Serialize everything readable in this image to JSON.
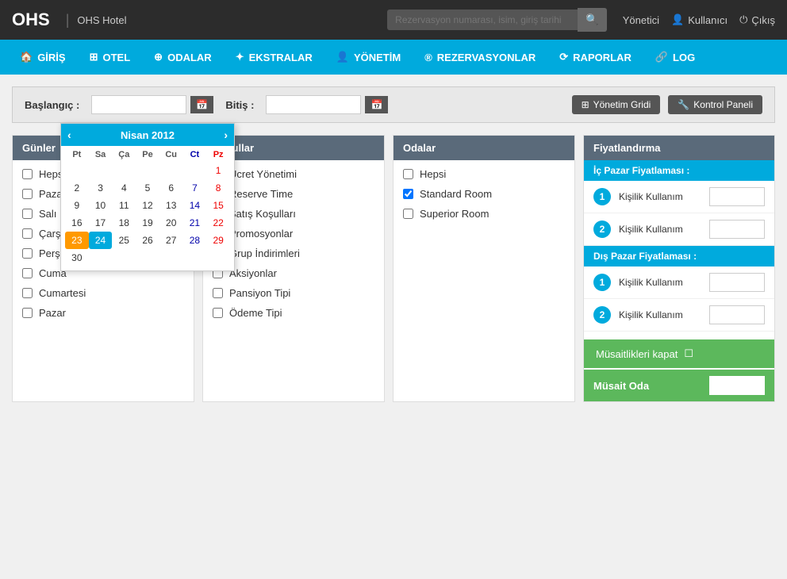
{
  "app": {
    "logo": "OHS",
    "hotel_name": "OHS Hotel",
    "search_placeholder": "Rezervasyon numarası, isim, giriş tarihi"
  },
  "topbar": {
    "manager_label": "Yönetici",
    "user_label": "Kullanıcı",
    "logout_label": "Çıkış"
  },
  "nav": {
    "items": [
      {
        "id": "giris",
        "icon": "🏠",
        "label": "GİRİŞ"
      },
      {
        "id": "otel",
        "icon": "🏨",
        "label": "OTEL"
      },
      {
        "id": "odalar",
        "icon": "🔲",
        "label": "ODALAR"
      },
      {
        "id": "ekstralar",
        "icon": "➕",
        "label": "EKSTRALAR"
      },
      {
        "id": "yonetim",
        "icon": "👤",
        "label": "YÖNETİM"
      },
      {
        "id": "rezervasyonlar",
        "icon": "®",
        "label": "REZERVASYONLAR"
      },
      {
        "id": "raporlar",
        "icon": "🔄",
        "label": "RAPORLAR"
      },
      {
        "id": "log",
        "icon": "🔗",
        "label": "LOG"
      }
    ]
  },
  "filter": {
    "start_label": "Başlangıç :",
    "end_label": "Bitiş :",
    "start_value": "",
    "end_value": "",
    "yonetim_grid": "Yönetim Gridi",
    "kontrol_panel": "Kontrol Paneli"
  },
  "calendar": {
    "title": "Nisan 2012",
    "day_headers": [
      "Pt",
      "Sa",
      "Ça",
      "Pe",
      "Cu",
      "Ct",
      "Pz"
    ],
    "weeks": [
      [
        "",
        "",
        "",
        "",
        "",
        "",
        "1"
      ],
      [
        "2",
        "3",
        "4",
        "5",
        "6",
        "7",
        "8"
      ],
      [
        "9",
        "10",
        "11",
        "12",
        "13",
        "14",
        "15"
      ],
      [
        "16",
        "17",
        "18",
        "19",
        "20",
        "21",
        "22"
      ],
      [
        "23",
        "24",
        "25",
        "26",
        "27",
        "28",
        "29"
      ],
      [
        "30",
        "",
        "",
        "",
        "",
        "",
        ""
      ]
    ],
    "today": "23",
    "selected": "24"
  },
  "gunler": {
    "header": "Günler",
    "items": [
      {
        "id": "hepsi",
        "label": "Hepsi",
        "checked": false
      },
      {
        "id": "pazartesi",
        "label": "Pazartesi",
        "checked": false
      },
      {
        "id": "sali",
        "label": "Salı",
        "checked": false
      },
      {
        "id": "carsamba",
        "label": "Çarşamba",
        "checked": false
      },
      {
        "id": "persembe",
        "label": "Perşembe",
        "checked": false
      },
      {
        "id": "cuma",
        "label": "Cuma",
        "checked": false
      },
      {
        "id": "cumartesi",
        "label": "Cumartesi",
        "checked": false
      },
      {
        "id": "pazar",
        "label": "Pazar",
        "checked": false
      }
    ]
  },
  "kosullar": {
    "header": "Koşullar",
    "items": [
      {
        "id": "ucret-yonetimi",
        "label": "Ücret Yönetimi",
        "checked": false
      },
      {
        "id": "reserve-time",
        "label": "Reserve Time",
        "checked": false
      },
      {
        "id": "satis-kosullari",
        "label": "Satış Koşulları",
        "checked": false
      },
      {
        "id": "promosyonlar",
        "label": "Promosyonlar",
        "checked": false
      },
      {
        "id": "grup-indirimleri",
        "label": "Grup İndirimleri",
        "checked": false
      },
      {
        "id": "aksiyonlar",
        "label": "Aksiyonlar",
        "checked": false
      },
      {
        "id": "pansiyon-tipi",
        "label": "Pansiyon Tipi",
        "checked": false
      },
      {
        "id": "odeme-tipi",
        "label": "Ödeme Tipi",
        "checked": false
      }
    ]
  },
  "odalar": {
    "header": "Odalar",
    "items": [
      {
        "id": "hepsi",
        "label": "Hepsi",
        "checked": false
      },
      {
        "id": "standard-room",
        "label": "Standard Room",
        "checked": true
      },
      {
        "id": "superior-room",
        "label": "Superior Room",
        "checked": false
      }
    ]
  },
  "fiyatlandirma": {
    "header": "Fiyatlandırma",
    "ic_pazar": "İç Pazar Fiyatlaması :",
    "dis_pazar": "Dış Pazar Fiyatlaması :",
    "rows": [
      {
        "number": "1",
        "label": "Kişilik Kullanım",
        "value": ""
      },
      {
        "number": "2",
        "label": "Kişilik Kullanım",
        "value": ""
      }
    ],
    "dis_rows": [
      {
        "number": "1",
        "label": "Kişilik Kullanım",
        "value": ""
      },
      {
        "number": "2",
        "label": "Kişilik Kullanım",
        "value": ""
      }
    ],
    "musaitlikleri_kapat": "Müsaitlikleri kapat",
    "musait_oda": "Müsait Oda"
  }
}
